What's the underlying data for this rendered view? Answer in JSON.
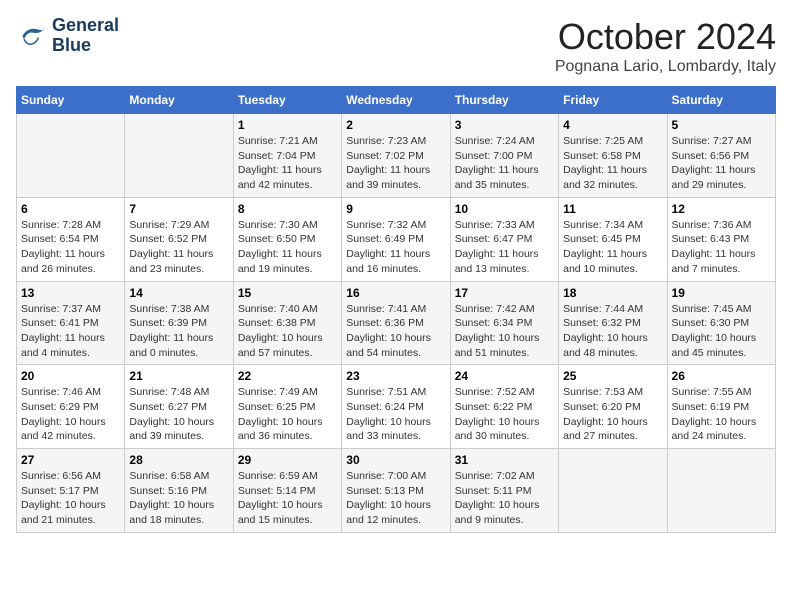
{
  "header": {
    "logo_line1": "General",
    "logo_line2": "Blue",
    "month_title": "October 2024",
    "location": "Pognana Lario, Lombardy, Italy"
  },
  "days_of_week": [
    "Sunday",
    "Monday",
    "Tuesday",
    "Wednesday",
    "Thursday",
    "Friday",
    "Saturday"
  ],
  "weeks": [
    [
      {
        "day": "",
        "info": ""
      },
      {
        "day": "",
        "info": ""
      },
      {
        "day": "1",
        "info": "Sunrise: 7:21 AM\nSunset: 7:04 PM\nDaylight: 11 hours and 42 minutes."
      },
      {
        "day": "2",
        "info": "Sunrise: 7:23 AM\nSunset: 7:02 PM\nDaylight: 11 hours and 39 minutes."
      },
      {
        "day": "3",
        "info": "Sunrise: 7:24 AM\nSunset: 7:00 PM\nDaylight: 11 hours and 35 minutes."
      },
      {
        "day": "4",
        "info": "Sunrise: 7:25 AM\nSunset: 6:58 PM\nDaylight: 11 hours and 32 minutes."
      },
      {
        "day": "5",
        "info": "Sunrise: 7:27 AM\nSunset: 6:56 PM\nDaylight: 11 hours and 29 minutes."
      }
    ],
    [
      {
        "day": "6",
        "info": "Sunrise: 7:28 AM\nSunset: 6:54 PM\nDaylight: 11 hours and 26 minutes."
      },
      {
        "day": "7",
        "info": "Sunrise: 7:29 AM\nSunset: 6:52 PM\nDaylight: 11 hours and 23 minutes."
      },
      {
        "day": "8",
        "info": "Sunrise: 7:30 AM\nSunset: 6:50 PM\nDaylight: 11 hours and 19 minutes."
      },
      {
        "day": "9",
        "info": "Sunrise: 7:32 AM\nSunset: 6:49 PM\nDaylight: 11 hours and 16 minutes."
      },
      {
        "day": "10",
        "info": "Sunrise: 7:33 AM\nSunset: 6:47 PM\nDaylight: 11 hours and 13 minutes."
      },
      {
        "day": "11",
        "info": "Sunrise: 7:34 AM\nSunset: 6:45 PM\nDaylight: 11 hours and 10 minutes."
      },
      {
        "day": "12",
        "info": "Sunrise: 7:36 AM\nSunset: 6:43 PM\nDaylight: 11 hours and 7 minutes."
      }
    ],
    [
      {
        "day": "13",
        "info": "Sunrise: 7:37 AM\nSunset: 6:41 PM\nDaylight: 11 hours and 4 minutes."
      },
      {
        "day": "14",
        "info": "Sunrise: 7:38 AM\nSunset: 6:39 PM\nDaylight: 11 hours and 0 minutes."
      },
      {
        "day": "15",
        "info": "Sunrise: 7:40 AM\nSunset: 6:38 PM\nDaylight: 10 hours and 57 minutes."
      },
      {
        "day": "16",
        "info": "Sunrise: 7:41 AM\nSunset: 6:36 PM\nDaylight: 10 hours and 54 minutes."
      },
      {
        "day": "17",
        "info": "Sunrise: 7:42 AM\nSunset: 6:34 PM\nDaylight: 10 hours and 51 minutes."
      },
      {
        "day": "18",
        "info": "Sunrise: 7:44 AM\nSunset: 6:32 PM\nDaylight: 10 hours and 48 minutes."
      },
      {
        "day": "19",
        "info": "Sunrise: 7:45 AM\nSunset: 6:30 PM\nDaylight: 10 hours and 45 minutes."
      }
    ],
    [
      {
        "day": "20",
        "info": "Sunrise: 7:46 AM\nSunset: 6:29 PM\nDaylight: 10 hours and 42 minutes."
      },
      {
        "day": "21",
        "info": "Sunrise: 7:48 AM\nSunset: 6:27 PM\nDaylight: 10 hours and 39 minutes."
      },
      {
        "day": "22",
        "info": "Sunrise: 7:49 AM\nSunset: 6:25 PM\nDaylight: 10 hours and 36 minutes."
      },
      {
        "day": "23",
        "info": "Sunrise: 7:51 AM\nSunset: 6:24 PM\nDaylight: 10 hours and 33 minutes."
      },
      {
        "day": "24",
        "info": "Sunrise: 7:52 AM\nSunset: 6:22 PM\nDaylight: 10 hours and 30 minutes."
      },
      {
        "day": "25",
        "info": "Sunrise: 7:53 AM\nSunset: 6:20 PM\nDaylight: 10 hours and 27 minutes."
      },
      {
        "day": "26",
        "info": "Sunrise: 7:55 AM\nSunset: 6:19 PM\nDaylight: 10 hours and 24 minutes."
      }
    ],
    [
      {
        "day": "27",
        "info": "Sunrise: 6:56 AM\nSunset: 5:17 PM\nDaylight: 10 hours and 21 minutes."
      },
      {
        "day": "28",
        "info": "Sunrise: 6:58 AM\nSunset: 5:16 PM\nDaylight: 10 hours and 18 minutes."
      },
      {
        "day": "29",
        "info": "Sunrise: 6:59 AM\nSunset: 5:14 PM\nDaylight: 10 hours and 15 minutes."
      },
      {
        "day": "30",
        "info": "Sunrise: 7:00 AM\nSunset: 5:13 PM\nDaylight: 10 hours and 12 minutes."
      },
      {
        "day": "31",
        "info": "Sunrise: 7:02 AM\nSunset: 5:11 PM\nDaylight: 10 hours and 9 minutes."
      },
      {
        "day": "",
        "info": ""
      },
      {
        "day": "",
        "info": ""
      }
    ]
  ]
}
